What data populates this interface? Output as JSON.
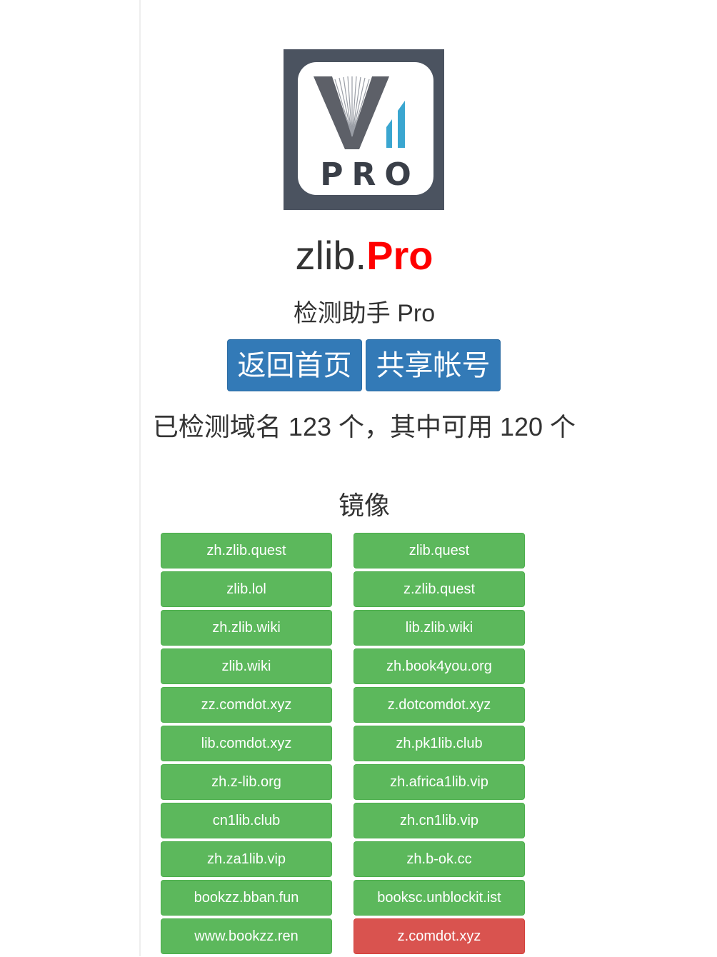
{
  "logo": {
    "text": "PRO",
    "colors": {
      "frame": "#4b5360",
      "letter": "#5d6068",
      "bars": "#3aa6d0"
    }
  },
  "brand": {
    "prefix": "zlib.",
    "suffix": "Pro"
  },
  "subtitle": "检测助手 Pro",
  "buttons": {
    "home": "返回首页",
    "share": "共享帐号"
  },
  "stats_text": "已检测域名 123 个，其中可用 120 个",
  "mirror_title": "镜像",
  "mirrors_left": [
    {
      "label": "zh.zlib.quest",
      "status": "up"
    },
    {
      "label": "zlib.lol",
      "status": "up"
    },
    {
      "label": "zh.zlib.wiki",
      "status": "up"
    },
    {
      "label": "zlib.wiki",
      "status": "up"
    },
    {
      "label": "zz.comdot.xyz",
      "status": "up"
    },
    {
      "label": "lib.comdot.xyz",
      "status": "up"
    },
    {
      "label": "zh.z-lib.org",
      "status": "up"
    },
    {
      "label": "cn1lib.club",
      "status": "up"
    },
    {
      "label": "zh.za1lib.vip",
      "status": "up"
    },
    {
      "label": "bookzz.bban.fun",
      "status": "up"
    },
    {
      "label": "www.bookzz.ren",
      "status": "up"
    }
  ],
  "mirrors_right": [
    {
      "label": "zlib.quest",
      "status": "up"
    },
    {
      "label": "z.zlib.quest",
      "status": "up"
    },
    {
      "label": "lib.zlib.wiki",
      "status": "up"
    },
    {
      "label": "zh.book4you.org",
      "status": "up"
    },
    {
      "label": "z.dotcomdot.xyz",
      "status": "up"
    },
    {
      "label": "zh.pk1lib.club",
      "status": "up"
    },
    {
      "label": "zh.africa1lib.vip",
      "status": "up"
    },
    {
      "label": "zh.cn1lib.vip",
      "status": "up"
    },
    {
      "label": "zh.b-ok.cc",
      "status": "up"
    },
    {
      "label": "booksc.unblockit.ist",
      "status": "up"
    },
    {
      "label": "z.comdot.xyz",
      "status": "down"
    }
  ],
  "colors": {
    "primary": "#337ab7",
    "success": "#5cb85c",
    "danger": "#d9534f",
    "brand_accent": "#ff0000"
  }
}
